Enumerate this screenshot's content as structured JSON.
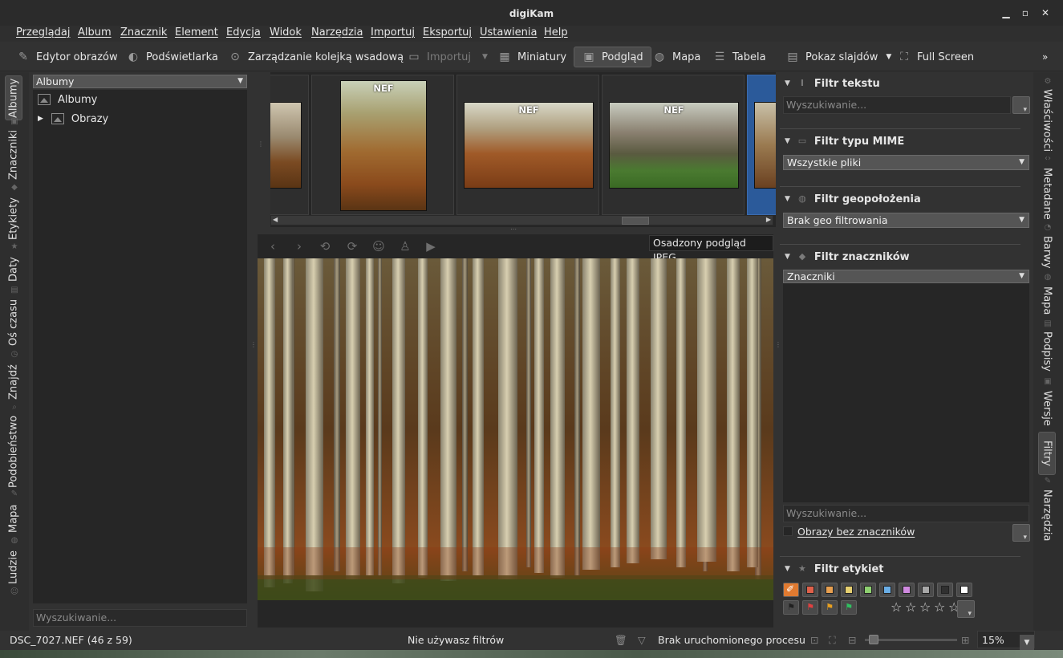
{
  "window": {
    "title": "digiKam"
  },
  "menu": [
    "Przeglądaj",
    "Album",
    "Znacznik",
    "Element",
    "Edycja",
    "Widok",
    "Narzędzia",
    "Importuj",
    "Eksportuj",
    "Ustawienia",
    "Help"
  ],
  "toolbar": {
    "image_editor": "Edytor obrazów",
    "light_table": "Podświetlarka",
    "batch_queue": "Zarządzanie kolejką wsadową",
    "import": "Importuj",
    "thumbnails": "Miniatury",
    "preview": "Podgląd",
    "map": "Mapa",
    "table": "Tabela",
    "slideshow": "Pokaz slajdów",
    "fullscreen": "Full Screen",
    "more": "»"
  },
  "left_tabs": [
    "Albumy",
    "Znaczniki",
    "Etykiety",
    "Daty",
    "Oś czasu",
    "Znajdź",
    "Podobieństwo",
    "Mapa",
    "Ludzie"
  ],
  "albums": {
    "selector": "Albumy",
    "tree": [
      "Albumy",
      "Obrazy"
    ],
    "search_placeholder": "Wyszukiwanie..."
  },
  "thumbnails": {
    "badge": "NEF"
  },
  "preview": {
    "mode_label": "Osadzony podgląd JPEG"
  },
  "filters": {
    "text": {
      "title": "Filtr tekstu",
      "placeholder": "Wyszukiwanie..."
    },
    "mime": {
      "title": "Filtr typu MIME",
      "value": "Wszystkie pliki"
    },
    "geo": {
      "title": "Filtr geopołożenia",
      "value": "Brak geo filtrowania"
    },
    "tags": {
      "title": "Filtr znaczników",
      "value": "Znaczniki",
      "placeholder": "Wyszukiwanie...",
      "untagged": "Obrazy bez znaczników"
    },
    "labels": {
      "title": "Filtr etykiet",
      "colors": [
        "#e87a2a",
        "#e0604a",
        "#e8a050",
        "#e6d070",
        "#8ed070",
        "#6aaee6",
        "#d08ae0",
        "#a8a8a8",
        "#303030",
        "#ffffff"
      ],
      "flags": [
        "#202020",
        "#e04040",
        "#e8a020",
        "#30c060"
      ]
    }
  },
  "right_tabs": [
    "Właściwości",
    "Metadane",
    "Barwy",
    "Mapa",
    "Podpisy",
    "Wersje",
    "Filtry",
    "Narzędzia"
  ],
  "status": {
    "file": "DSC_7027.NEF (46 z 59)",
    "filter": "Nie używasz filtrów",
    "process": "Brak uruchomionego procesu",
    "zoom": "15%",
    "zoom_fraction": 0.05
  }
}
